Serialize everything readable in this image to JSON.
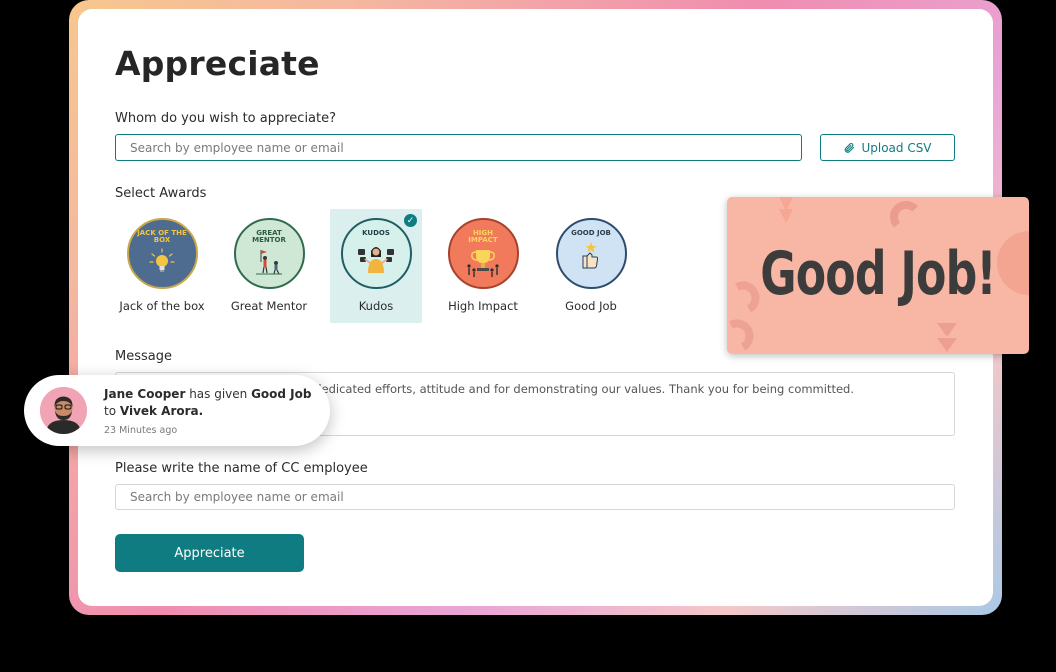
{
  "page": {
    "title": "Appreciate",
    "recipient_label": "Whom do you wish to appreciate?",
    "recipient_placeholder": "Search by employee name or email",
    "upload_csv_label": "Upload CSV",
    "awards_label": "Select Awards",
    "message_label": "Message",
    "message_text": "for your continuous excellence, dedicated efforts, attitude and for demonstrating our values. Thank you for being committed.",
    "cc_label": "Please write the name of CC employee",
    "cc_placeholder": "Search by employee name or email",
    "submit_label": "Appreciate"
  },
  "awards": [
    {
      "name": "Jack of the box",
      "badge_text": "JACK OF THE BOX",
      "color": "#4d6c8f",
      "ring": "#c8a64a",
      "text_color": "#f4c542",
      "selected": false
    },
    {
      "name": "Great Mentor",
      "badge_text": "GREAT MENTOR",
      "color": "#cfe8d6",
      "ring": "#2f6b4e",
      "text_color": "#2f5a44",
      "selected": false
    },
    {
      "name": "Kudos",
      "badge_text": "KUDOS",
      "color": "#d6f1ec",
      "ring": "#1f5e63",
      "text_color": "#1f3f44",
      "selected": true
    },
    {
      "name": "High Impact",
      "badge_text": "HIGH IMPACT",
      "color": "#f17a5c",
      "ring": "#a8412d",
      "text_color": "#f9d55a",
      "selected": false
    },
    {
      "name": "Good Job",
      "badge_text": "GOOD JOB",
      "color": "#cfe3f4",
      "ring": "#2c4d6e",
      "text_color": "#2c3d50",
      "selected": false
    }
  ],
  "toast": {
    "giver": "Jane Cooper",
    "middle": " has given ",
    "award": "Good Job",
    "to_word": "to ",
    "receiver": "Vivek Arora.",
    "time": "23 Minutes ago"
  },
  "goodjob_card": {
    "text": "Good Job!",
    "color": "#f8b7a4"
  },
  "colors": {
    "accent": "#0e7c80"
  }
}
